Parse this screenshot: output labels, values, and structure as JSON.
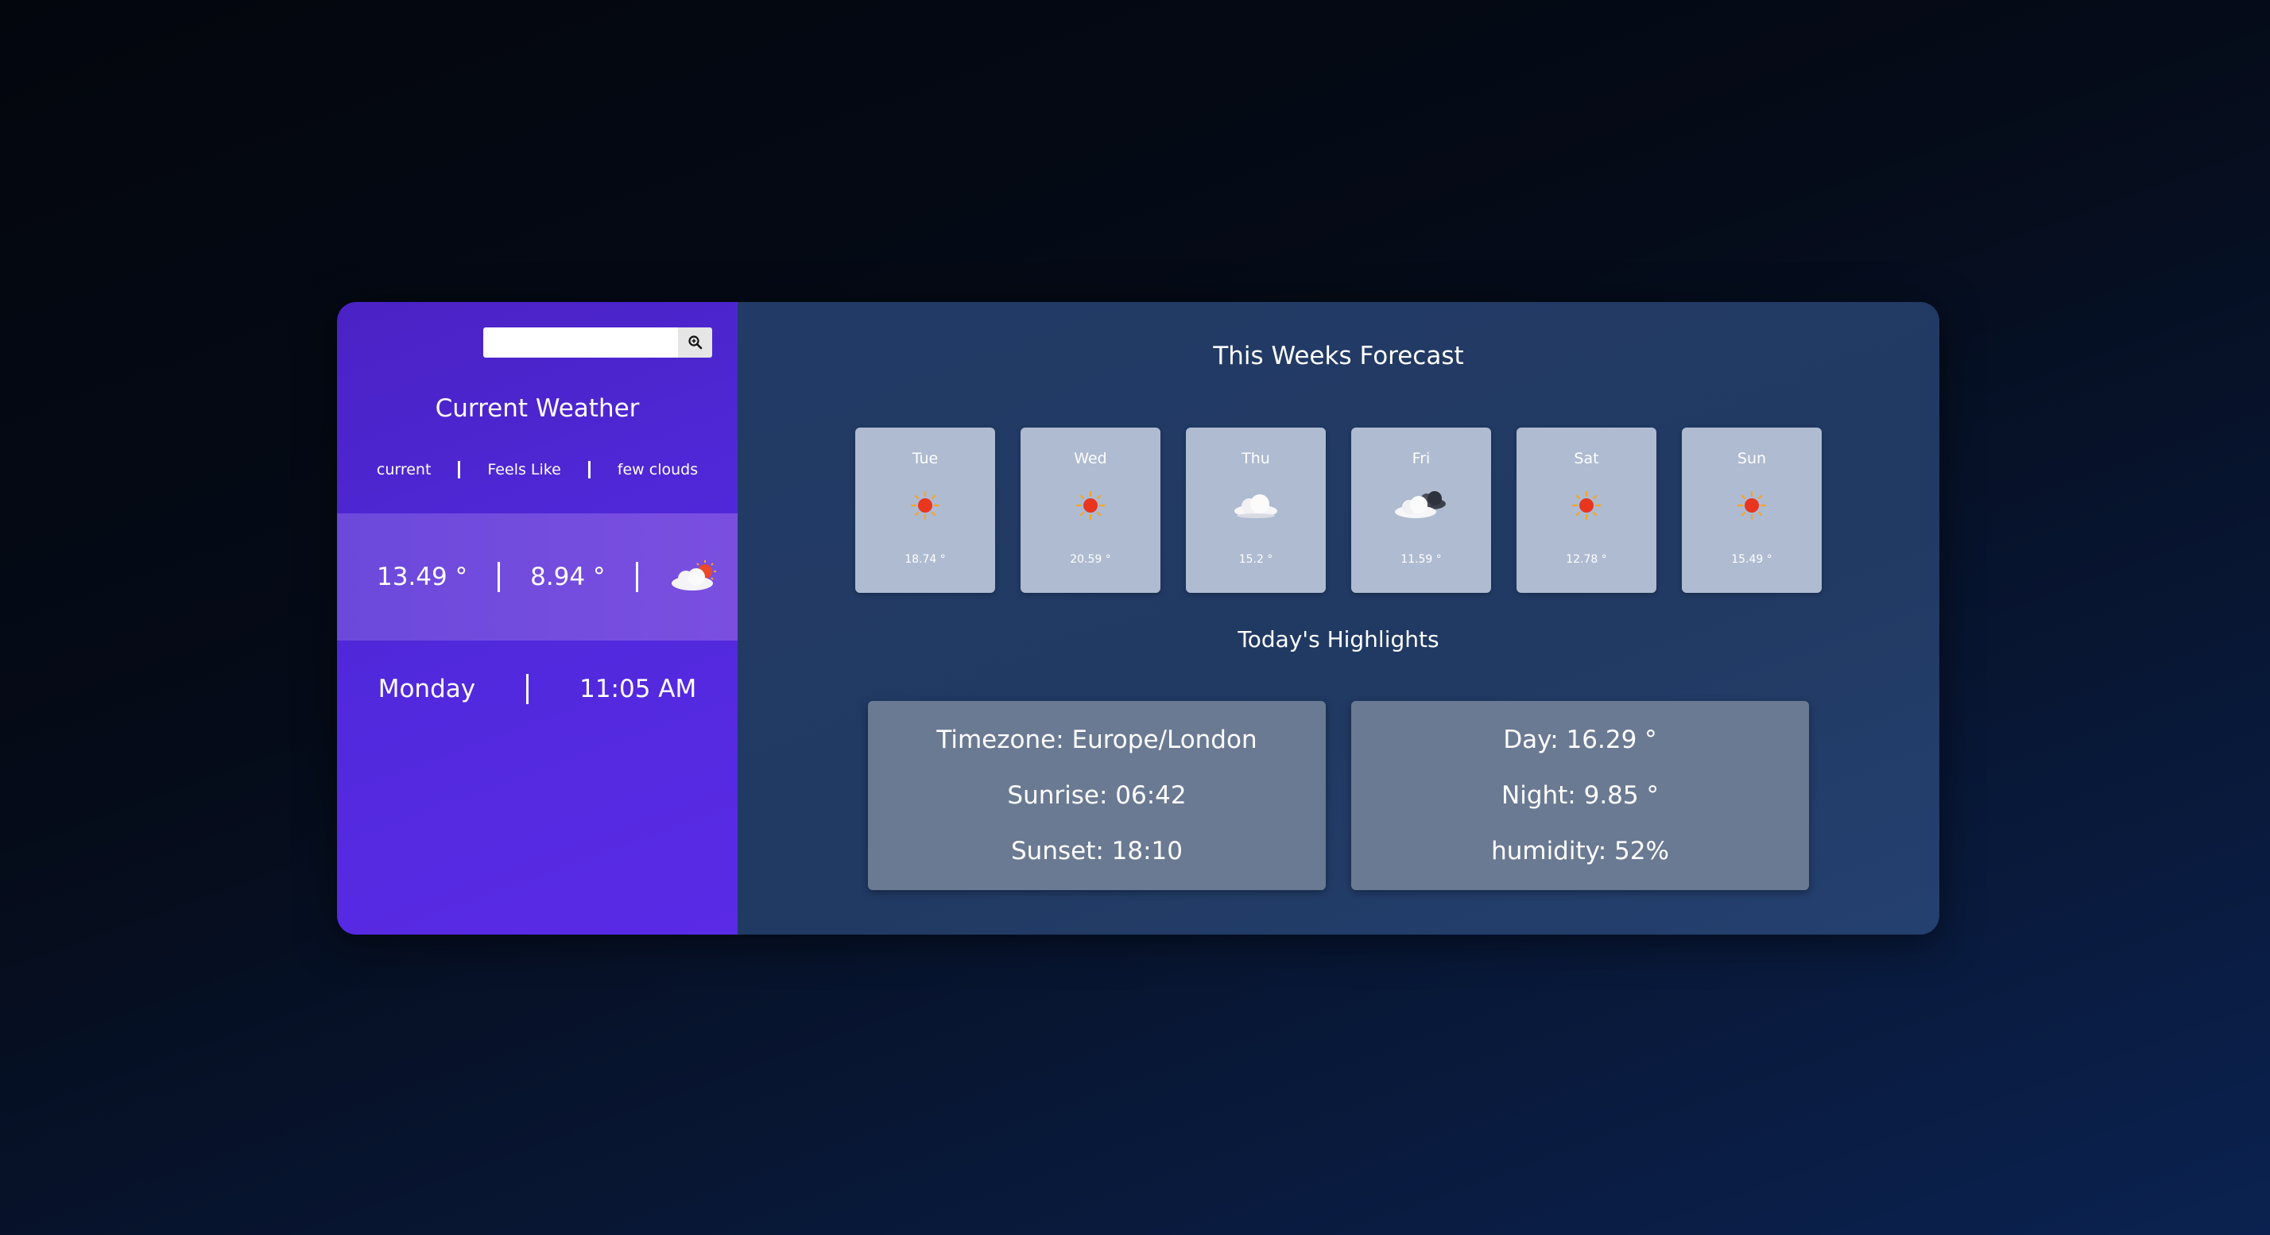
{
  "search": {
    "placeholder": "",
    "value": "",
    "button_icon": "search-icon"
  },
  "current": {
    "title": "Current Weather",
    "labels": [
      "current",
      "Feels Like",
      "few clouds"
    ],
    "temp": "13.49 °",
    "feels_like": "8.94 °",
    "icon": "few-clouds-icon",
    "day": "Monday",
    "time": "11:05 AM"
  },
  "forecast": {
    "title": "This Weeks Forecast",
    "days": [
      {
        "name": "Tue",
        "temp": "18.74 °",
        "icon": "sun-icon"
      },
      {
        "name": "Wed",
        "temp": "20.59 °",
        "icon": "sun-icon"
      },
      {
        "name": "Thu",
        "temp": "15.2 °",
        "icon": "cloud-icon"
      },
      {
        "name": "Fri",
        "temp": "11.59 °",
        "icon": "broken-clouds-icon"
      },
      {
        "name": "Sat",
        "temp": "12.78 °",
        "icon": "sun-icon"
      },
      {
        "name": "Sun",
        "temp": "15.49 °",
        "icon": "sun-icon"
      }
    ]
  },
  "highlights": {
    "title": "Today's Highlights",
    "timezone": "Timezone: Europe/London",
    "sunrise": "Sunrise: 06:42",
    "sunset": "Sunset: 18:10",
    "day": "Day: 16.29 °",
    "night": "Night: 9.85 °",
    "humidity": "humidity: 52%"
  },
  "colors": {
    "left_panel": "#5129dc",
    "right_panel": "#223b66",
    "day_card": "#aebbd1",
    "highlight_card": "#6b7a93"
  }
}
